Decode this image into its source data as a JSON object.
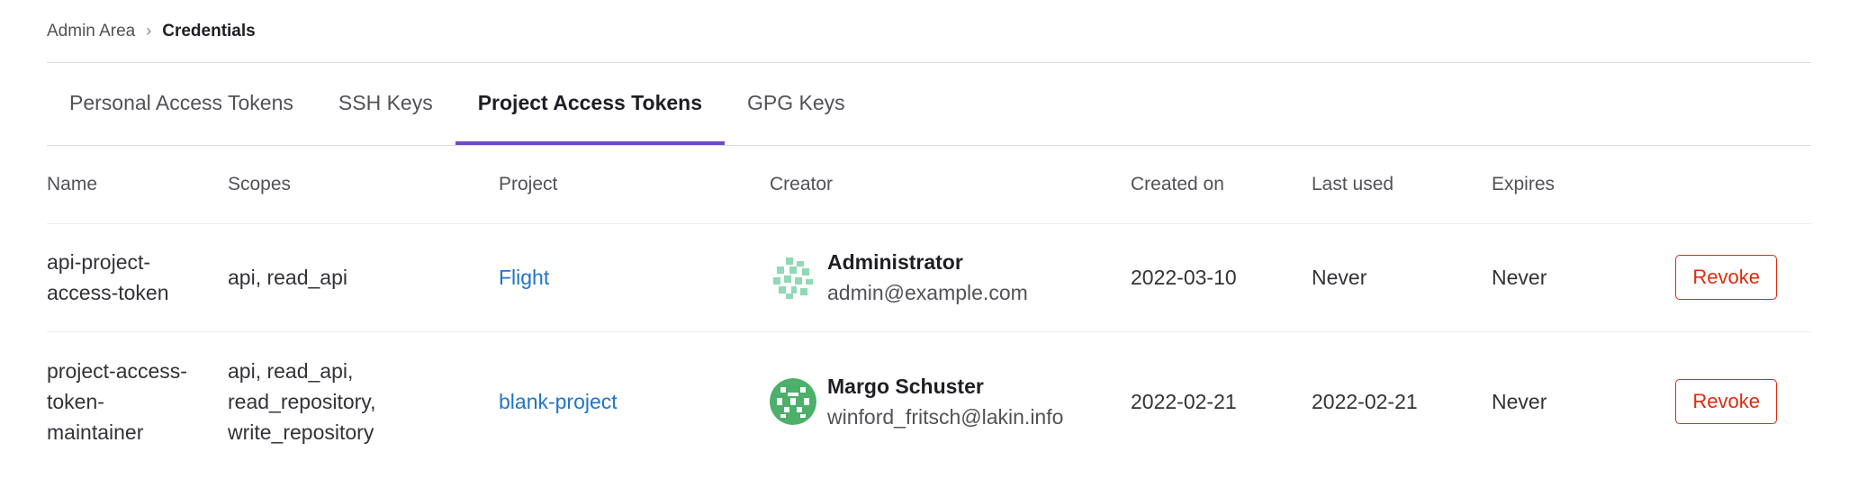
{
  "breadcrumb": {
    "parent": "Admin Area",
    "separator": "›",
    "current": "Credentials"
  },
  "tabs": [
    {
      "label": "Personal Access Tokens",
      "active": false
    },
    {
      "label": "SSH Keys",
      "active": false
    },
    {
      "label": "Project Access Tokens",
      "active": true
    },
    {
      "label": "GPG Keys",
      "active": false
    }
  ],
  "table": {
    "headers": [
      "Name",
      "Scopes",
      "Project",
      "Creator",
      "Created on",
      "Last used",
      "Expires",
      ""
    ],
    "rows": [
      {
        "name_lines": [
          "api-project-",
          "access-token"
        ],
        "scopes_lines": [
          "api, read_api"
        ],
        "project": "Flight",
        "creator_name": "Administrator",
        "creator_email": "admin@example.com",
        "created_on": "2022-03-10",
        "last_used": "Never",
        "expires": "Never",
        "action": "Revoke"
      },
      {
        "name_lines": [
          "project-access-",
          "token-",
          "maintainer"
        ],
        "scopes_lines": [
          "api, read_api,",
          "read_repository,",
          "write_repository"
        ],
        "project": "blank-project",
        "creator_name": "Margo Schuster",
        "creator_email": "winford_fritsch@lakin.info",
        "created_on": "2022-02-21",
        "last_used": "2022-02-21",
        "expires": "Never",
        "action": "Revoke"
      }
    ]
  },
  "colors": {
    "accent": "#6e49cb",
    "link": "#1f75cb",
    "danger": "#dd2b0e",
    "avatar_admin": "#8fd9b4",
    "avatar_margo": "#4caf6a"
  },
  "icons": {
    "avatar_1": "identicon-avatar",
    "avatar_2": "identicon-avatar"
  }
}
